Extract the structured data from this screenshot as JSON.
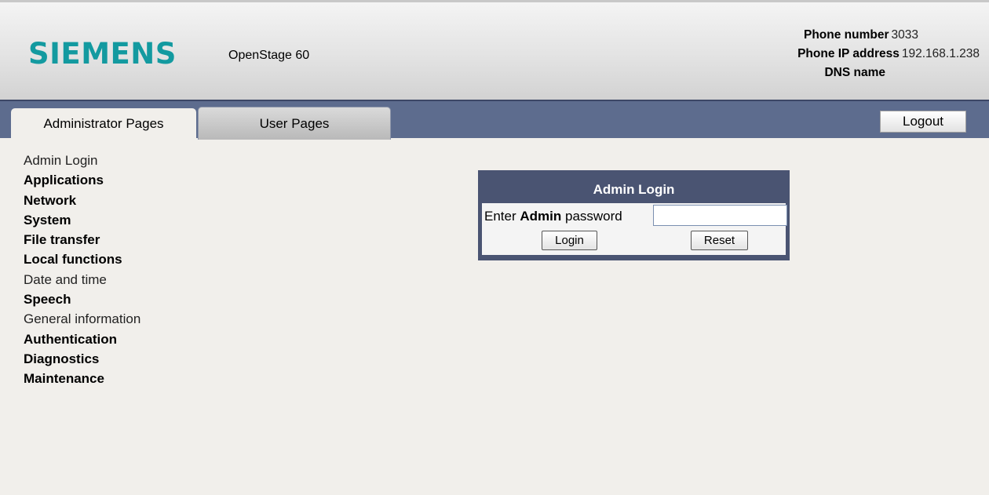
{
  "header": {
    "brand": "SIEMENS",
    "model": "OpenStage 60",
    "phone_number_label": "Phone number",
    "phone_number_value": "3033",
    "phone_ip_label": "Phone IP address",
    "phone_ip_value": "192.168.1.238",
    "dns_label": "DNS name",
    "brand_color": "#139aa0"
  },
  "nav": {
    "tabs": [
      {
        "label": "Administrator Pages",
        "active": true
      },
      {
        "label": "User Pages",
        "active": false
      }
    ],
    "logout_label": "Logout",
    "bar_color": "#5d6c8e"
  },
  "sidebar": {
    "items": [
      {
        "label": "Admin Login",
        "style": "link"
      },
      {
        "label": "Applications",
        "style": "section"
      },
      {
        "label": "Network",
        "style": "section"
      },
      {
        "label": "System",
        "style": "section"
      },
      {
        "label": "File transfer",
        "style": "section"
      },
      {
        "label": "Local functions",
        "style": "section"
      },
      {
        "label": "Date and time",
        "style": "link"
      },
      {
        "label": "Speech",
        "style": "section"
      },
      {
        "label": "General information",
        "style": "link"
      },
      {
        "label": "Authentication",
        "style": "section"
      },
      {
        "label": "Diagnostics",
        "style": "section"
      },
      {
        "label": "Maintenance",
        "style": "section"
      }
    ]
  },
  "login": {
    "title": "Admin Login",
    "prompt_prefix": "Enter",
    "prompt_bold": "Admin",
    "prompt_suffix": "password",
    "password_value": "",
    "login_label": "Login",
    "reset_label": "Reset"
  }
}
